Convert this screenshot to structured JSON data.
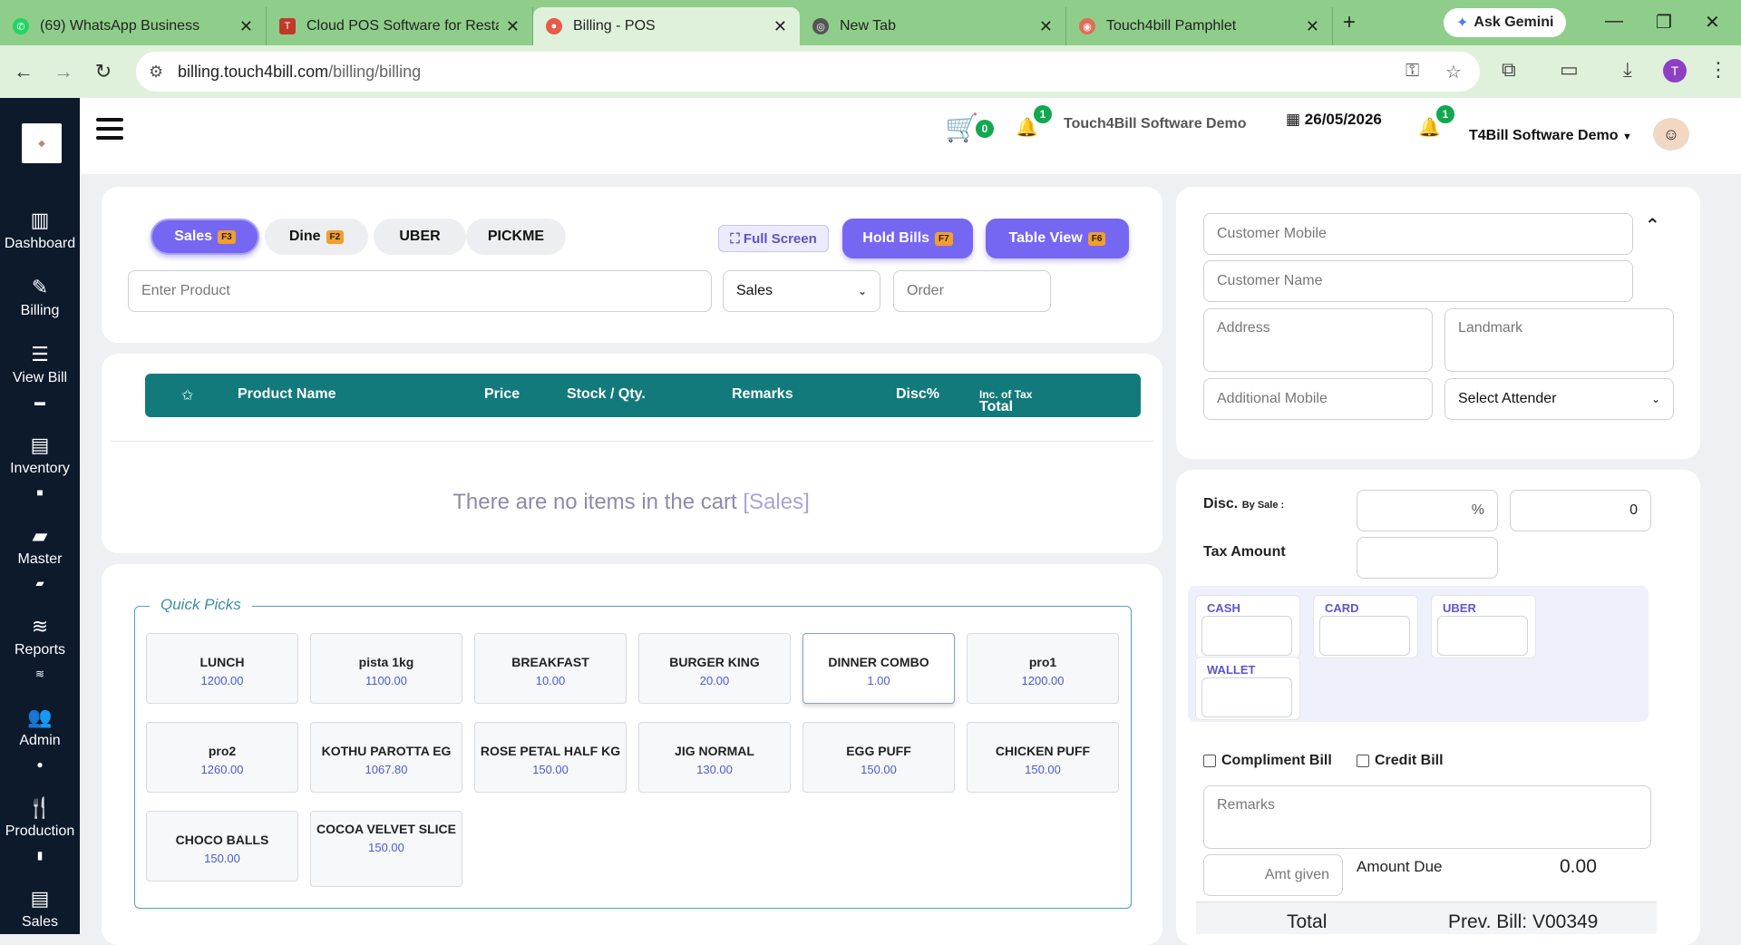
{
  "browser": {
    "tabs": [
      {
        "title": "(69) WhatsApp Business",
        "active": false
      },
      {
        "title": "Cloud POS Software for Restau",
        "active": false
      },
      {
        "title": "Billing - POS",
        "active": true
      },
      {
        "title": "New Tab",
        "active": false
      },
      {
        "title": "Touch4bill Pamphlet",
        "active": false
      }
    ],
    "gemini_label": "Ask Gemini",
    "url_host": "billing.touch4bill.com",
    "url_path": "/billing/billing",
    "profile_initial": "T"
  },
  "sidebar": {
    "items": [
      {
        "label": "Dashboard",
        "icon": "bar-chart-icon"
      },
      {
        "label": "Billing",
        "icon": "edit-icon"
      },
      {
        "label": "View Bill",
        "icon": "list-icon"
      },
      {
        "label": "Inventory",
        "icon": "archive-icon"
      },
      {
        "label": "Master",
        "icon": "folder-icon"
      },
      {
        "label": "Reports",
        "icon": "stack-icon"
      },
      {
        "label": "Admin",
        "icon": "users-icon"
      },
      {
        "label": "Production",
        "icon": "utensils-icon"
      },
      {
        "label": "Sales",
        "icon": "archive-icon"
      }
    ]
  },
  "header": {
    "cart_count": "0",
    "notif_count": "1",
    "brand": "Touch4Bill Software Demo",
    "date": "26/05/2026",
    "alert_count": "1",
    "user": "T4Bill Software Demo"
  },
  "order": {
    "tabs": [
      {
        "label": "Sales",
        "key": "F3",
        "active": true
      },
      {
        "label": "Dine",
        "key": "F2",
        "active": false
      },
      {
        "label": "UBER",
        "key": "",
        "active": false
      },
      {
        "label": "PICKME",
        "key": "",
        "active": false
      }
    ],
    "fullscreen_label": "Full Screen",
    "hold_bills_label": "Hold Bills",
    "hold_bills_key": "F7",
    "table_view_label": "Table View",
    "table_view_key": "F6",
    "product_placeholder": "Enter Product",
    "mode_selected": "Sales",
    "order_placeholder": "Order"
  },
  "cart": {
    "columns": [
      "Product Name",
      "Price",
      "Stock / Qty.",
      "Remarks",
      "Disc%",
      "Total"
    ],
    "total_suffix": "Inc. of Tax",
    "empty_text": "There are no items in the cart",
    "empty_category": "[Sales]"
  },
  "quick_picks": {
    "title": "Quick Picks",
    "items": [
      {
        "name": "LUNCH",
        "price": "1200.00"
      },
      {
        "name": "pista 1kg",
        "price": "1100.00"
      },
      {
        "name": "BREAKFAST",
        "price": "10.00"
      },
      {
        "name": "BURGER KING",
        "price": "20.00"
      },
      {
        "name": "DINNER COMBO",
        "price": "1.00"
      },
      {
        "name": "pro1",
        "price": "1200.00"
      },
      {
        "name": "pro2",
        "price": "1260.00"
      },
      {
        "name": "KOTHU PAROTTA EG",
        "price": "1067.80"
      },
      {
        "name": "ROSE PETAL HALF KG",
        "price": "150.00"
      },
      {
        "name": "JIG NORMAL",
        "price": "130.00"
      },
      {
        "name": "EGG PUFF",
        "price": "150.00"
      },
      {
        "name": "CHICKEN PUFF",
        "price": "150.00"
      },
      {
        "name": "CHOCO BALLS",
        "price": "150.00"
      },
      {
        "name": "COCOA VELVET SLICE",
        "price": "150.00"
      }
    ]
  },
  "customer": {
    "mobile_placeholder": "Customer Mobile",
    "name_placeholder": "Customer Name",
    "address_placeholder": "Address",
    "landmark_placeholder": "Landmark",
    "additional_mobile_placeholder": "Additional Mobile",
    "attender_selected": "Select Attender"
  },
  "payment": {
    "disc_label": "Disc.",
    "disc_sub": "By Sale :",
    "disc_pct_symbol": "%",
    "disc_amount": "0",
    "tax_label": "Tax Amount",
    "methods": [
      "CASH",
      "CARD",
      "UBER",
      "WALLET"
    ],
    "compliment_label": "Compliment Bill",
    "credit_label": "Credit Bill",
    "remarks_placeholder": "Remarks",
    "amt_given_placeholder": "Amt given",
    "amount_due_label": "Amount Due",
    "amount_due_value": "0.00",
    "total_label": "Total",
    "prev_bill": "Prev. Bill: V00349"
  }
}
